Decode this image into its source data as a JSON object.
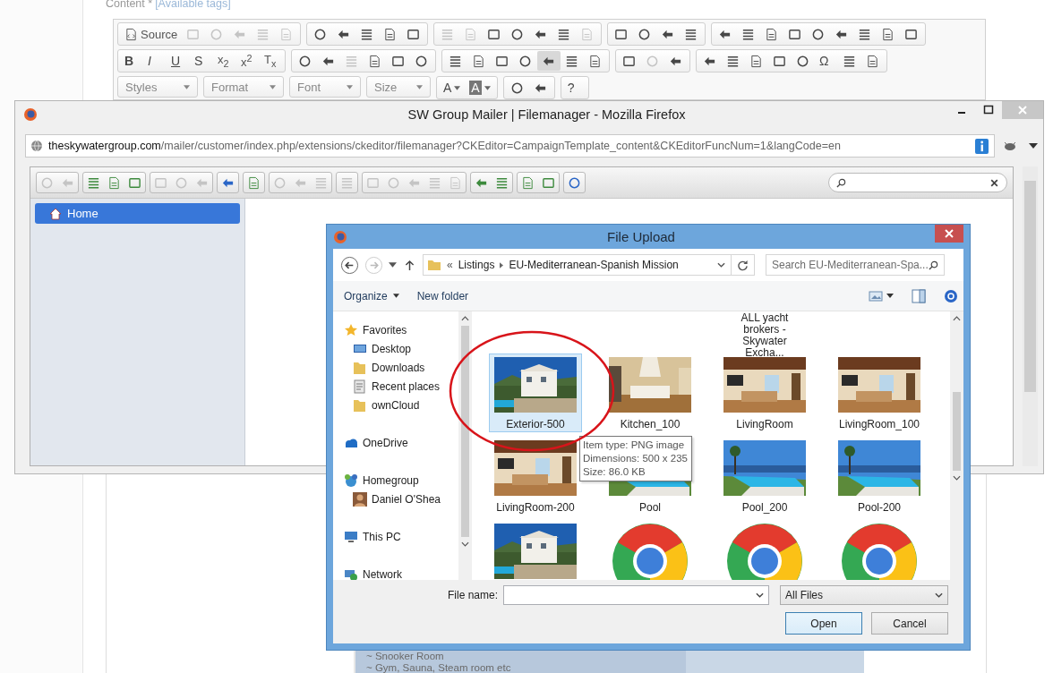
{
  "editor": {
    "label": "Content *",
    "tags_link": "[Available tags]",
    "toolbar": [
      [
        [
          {
            "label": "Source"
          },
          {
            "disabled": true
          },
          {
            "disabled": true
          },
          {
            "disabled": true
          },
          {
            "disabled": true
          },
          {
            "disabled": true
          }
        ],
        [
          {
            "disabled": false
          },
          {
            "disabled": false
          },
          {
            "disabled": false
          },
          {
            "disabled": false
          },
          {
            "disabled": false
          }
        ],
        [
          {
            "disabled": true
          },
          {
            "disabled": true
          },
          {
            "disabled": false
          },
          {
            "disabled": false
          },
          {
            "disabled": false
          },
          {
            "disabled": false
          },
          {
            "disabled": true
          }
        ],
        [
          {
            "disabled": false
          },
          {
            "disabled": false
          },
          {
            "disabled": false
          },
          {
            "disabled": false
          }
        ],
        [
          {
            "disabled": false
          },
          {
            "disabled": false
          },
          {
            "disabled": false
          },
          {
            "disabled": false
          },
          {
            "disabled": false
          },
          {
            "disabled": false
          },
          {
            "disabled": false
          },
          {
            "disabled": false
          },
          {
            "disabled": false
          }
        ]
      ],
      [
        [
          {
            "label": "B"
          },
          {
            "label": "I"
          },
          {
            "label": "U"
          },
          {
            "label": "S"
          },
          {
            "label": "x$_{2}$"
          },
          {
            "label": "x$^{2}$"
          },
          {
            "label": "T$_{x}$"
          }
        ],
        [
          {
            "disabled": false
          },
          {
            "disabled": false
          },
          {
            "disabled": true
          },
          {
            "disabled": false
          },
          {
            "disabled": false
          },
          {
            "disabled": false
          }
        ],
        [
          {
            "on": false
          },
          {
            "on": false
          },
          {
            "on": false
          },
          {
            "on": false
          },
          {
            "on": true
          },
          {
            "on": false
          },
          {
            "on": false
          }
        ],
        [
          {
            "disabled": false
          },
          {
            "disabled": true
          },
          {
            "disabled": false
          }
        ],
        [
          {
            "disabled": false
          },
          {
            "disabled": false
          },
          {
            "disabled": false
          },
          {
            "disabled": false
          },
          {
            "disabled": false
          },
          {
            "label": "Ω"
          },
          {
            "disabled": false
          },
          {
            "disabled": false
          }
        ]
      ],
      [
        [
          {
            "label": "A"
          },
          {
            "label": "A"
          }
        ],
        [
          {
            "disabled": false
          },
          {
            "disabled": false
          }
        ],
        [
          {
            "label": "?"
          }
        ]
      ]
    ],
    "combos": [
      "Styles",
      "Format",
      "Font",
      "Size"
    ],
    "lines": [
      "~ Snooker Room",
      "~ Gym, Sauna, Steam room etc"
    ]
  },
  "browser": {
    "title": "SW Group Mailer | Filemanager - Mozilla Firefox",
    "url": {
      "host": "theskywatergroup.com",
      "path": "/mailer/customer/index.php/extensions/ckeditor/filemanager?CKEditor=CampaignTemplate_content&CKEditorFuncNum=1&langCode=en"
    },
    "toolbar": [
      [
        {
          "disabled": true
        },
        {
          "disabled": true
        }
      ],
      [
        {
          "disabled": false
        },
        {
          "disabled": false
        },
        {
          "disabled": false
        }
      ],
      [
        {
          "disabled": true
        },
        {
          "disabled": true
        },
        {
          "disabled": true
        }
      ],
      [
        {
          "disabled": false
        }
      ],
      [
        {
          "disabled": false
        }
      ],
      [
        {
          "disabled": true
        },
        {
          "disabled": true
        },
        {
          "disabled": true
        }
      ],
      [
        {
          "disabled": true
        }
      ],
      [
        {
          "disabled": true
        },
        {
          "disabled": true
        },
        {
          "disabled": true
        },
        {
          "disabled": true
        },
        {
          "disabled": true
        }
      ],
      [
        {
          "disabled": false
        },
        {
          "disabled": false
        }
      ],
      [
        {
          "disabled": false
        },
        {
          "disabled": false
        }
      ],
      [
        {
          "disabled": false
        }
      ]
    ],
    "tree": [
      {
        "label": "Home",
        "selected": true
      }
    ]
  },
  "dialog": {
    "title": "File Upload",
    "path_mark": "«",
    "breadcrumb": [
      "Listings",
      "EU-Mediterranean-Spanish Mission"
    ],
    "search": {
      "placeholder": "Search EU-Mediterranean-Spa..."
    },
    "commands": [
      {
        "label": "Organize",
        "dropdown": true
      },
      {
        "label": "New folder",
        "dropdown": false
      }
    ],
    "nav": [
      {
        "label": "Favorites",
        "kind": "star",
        "children": [
          {
            "label": "Desktop",
            "kind": "screen"
          },
          {
            "label": "Downloads",
            "kind": "folder"
          },
          {
            "label": "Recent places",
            "kind": "places"
          },
          {
            "label": "ownCloud",
            "kind": "folder"
          }
        ]
      },
      {
        "label": "OneDrive",
        "kind": "cloud"
      },
      {
        "label": "Homegroup",
        "kind": "group",
        "children": [
          {
            "label": "Daniel O'Shea",
            "kind": "person"
          }
        ]
      },
      {
        "label": "This PC",
        "kind": "pc"
      },
      {
        "label": "Network",
        "kind": "network"
      }
    ],
    "files": [
      {
        "kind": "caption",
        "label": "ALL yacht brokers - Skywater Excha..."
      },
      {
        "kind": "picture",
        "label": "Exterior-500",
        "selected": true
      },
      {
        "kind": "picture",
        "label": "Kitchen_100",
        "selected": false
      },
      {
        "kind": "picture",
        "label": "LivingRoom",
        "selected": false
      },
      {
        "kind": "picture",
        "label": "LivingRoom_100",
        "selected": false
      },
      {
        "kind": "picture",
        "label": "LivingRoom-200",
        "selected": false
      },
      {
        "kind": "picture",
        "label": "Pool",
        "selected": false
      },
      {
        "kind": "picture",
        "label": "Pool_200",
        "selected": false
      },
      {
        "kind": "picture",
        "label": "Pool-200",
        "selected": false
      },
      {
        "kind": "picture",
        "selected": false
      },
      {
        "kind": "logo",
        "selected": false
      },
      {
        "kind": "logo",
        "selected": false
      },
      {
        "kind": "logo",
        "selected": false
      }
    ],
    "tooltip": [
      "Item type: PNG image",
      "Dimensions: 500 x 235",
      "Size: 86.0 KB"
    ],
    "file_name_label": "File name:",
    "filter": "All Files",
    "buttons": [
      "Open",
      "Cancel"
    ]
  }
}
